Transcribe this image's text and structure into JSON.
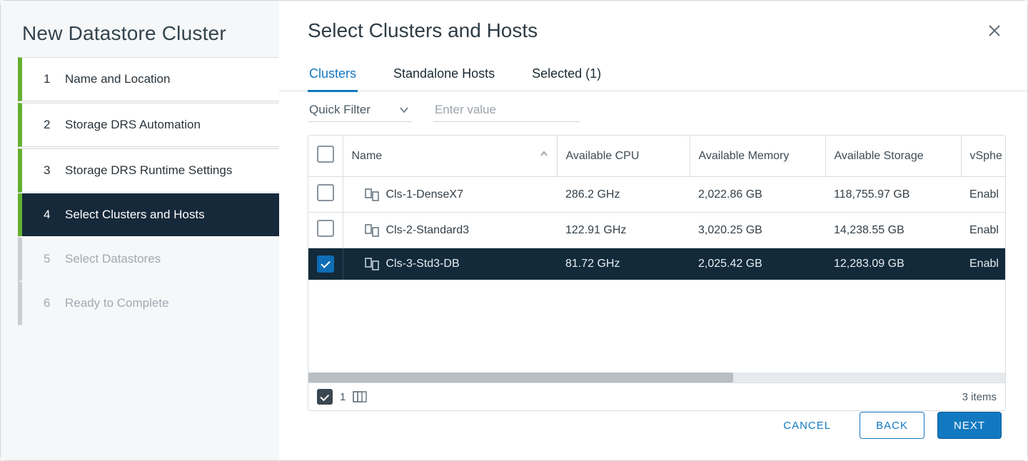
{
  "wizard": {
    "title": "New Datastore Cluster",
    "steps": [
      {
        "num": "1",
        "label": "Name and Location",
        "state": "visited"
      },
      {
        "num": "2",
        "label": "Storage DRS Automation",
        "state": "visited"
      },
      {
        "num": "3",
        "label": "Storage DRS Runtime Settings",
        "state": "visited"
      },
      {
        "num": "4",
        "label": "Select Clusters and Hosts",
        "state": "active"
      },
      {
        "num": "5",
        "label": "Select Datastores",
        "state": "disabled"
      },
      {
        "num": "6",
        "label": "Ready to Complete",
        "state": "disabled"
      }
    ]
  },
  "page": {
    "title": "Select Clusters and Hosts",
    "tabs": [
      {
        "label": "Clusters",
        "active": true
      },
      {
        "label": "Standalone Hosts",
        "active": false
      },
      {
        "label": "Selected (1)",
        "active": false
      }
    ],
    "filter": {
      "dropdown_label": "Quick Filter",
      "input_placeholder": "Enter value"
    },
    "table": {
      "columns": [
        {
          "key": "name",
          "label": "Name",
          "sorted": "asc"
        },
        {
          "key": "cpu",
          "label": "Available CPU"
        },
        {
          "key": "mem",
          "label": "Available Memory"
        },
        {
          "key": "stor",
          "label": "Available Storage"
        },
        {
          "key": "vsphere",
          "label": "vSphe"
        }
      ],
      "rows": [
        {
          "checked": false,
          "name": "Cls-1-DenseX7",
          "cpu": "286.2 GHz",
          "mem": "2,022.86 GB",
          "stor": "118,755.97 GB",
          "vsphere": "Enabl"
        },
        {
          "checked": false,
          "name": "Cls-2-Standard3",
          "cpu": "122.91 GHz",
          "mem": "3,020.25 GB",
          "stor": "14,238.55 GB",
          "vsphere": "Enabl"
        },
        {
          "checked": true,
          "name": "Cls-3-Std3-DB",
          "cpu": "81.72 GHz",
          "mem": "2,025.42 GB",
          "stor": "12,283.09 GB",
          "vsphere": "Enabl"
        }
      ],
      "footer": {
        "selected_count": "1",
        "items_text": "3 items"
      }
    },
    "buttons": {
      "cancel": "CANCEL",
      "back": "BACK",
      "next": "NEXT"
    }
  }
}
